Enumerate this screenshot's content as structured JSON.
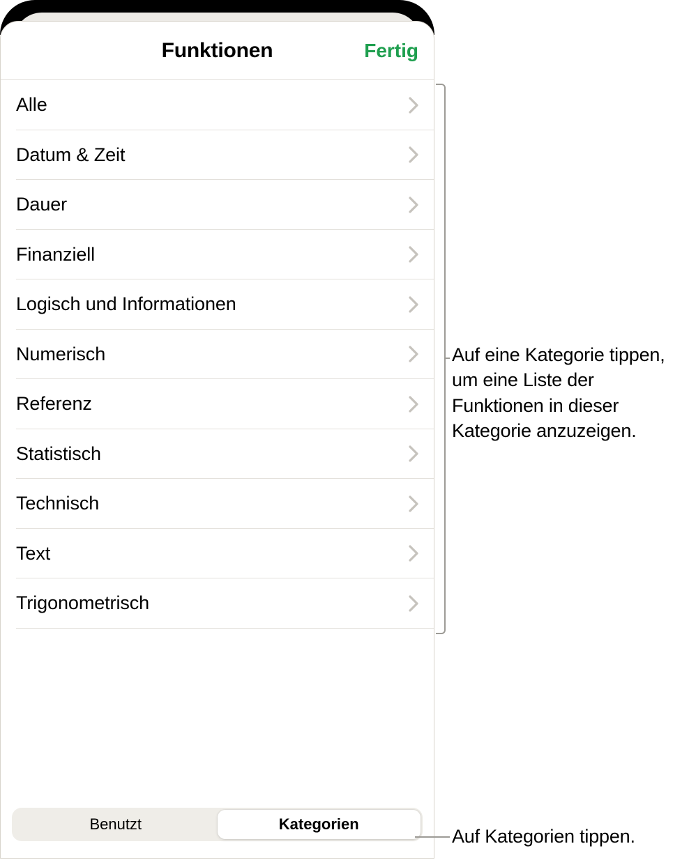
{
  "sheet": {
    "title": "Funktionen",
    "done": "Fertig",
    "categories": [
      "Alle",
      "Datum & Zeit",
      "Dauer",
      "Finanziell",
      "Logisch und Informationen",
      "Numerisch",
      "Referenz",
      "Statistisch",
      "Technisch",
      "Text",
      "Trigonometrisch"
    ],
    "segmented": {
      "recent": "Benutzt",
      "categories": "Kategorien",
      "active": "categories"
    }
  },
  "callouts": {
    "list": "Auf eine Kategorie tippen, um eine Liste der Funktionen in dieser Kategorie anzuzeigen.",
    "tab": "Auf Kategorien tippen."
  }
}
